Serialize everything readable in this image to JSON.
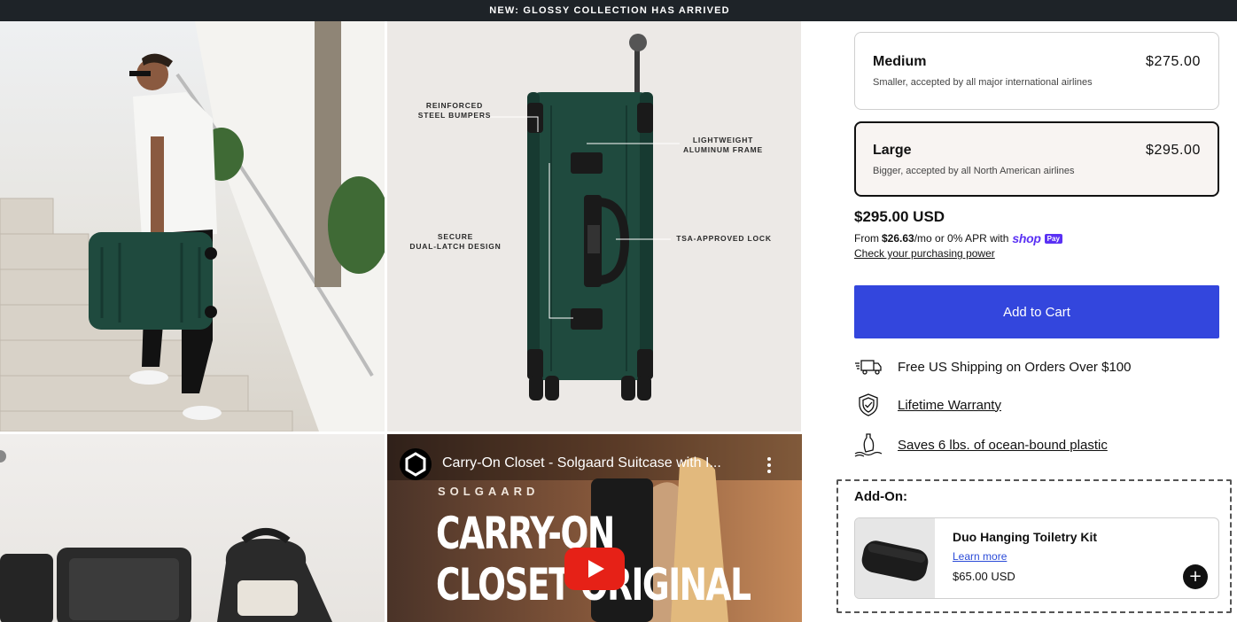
{
  "announcement": "NEW: GLOSSY COLLECTION HAS ARRIVED",
  "gallery": {
    "callouts": {
      "reinforced": "REINFORCED\nSTEEL BUMPERS",
      "lightweight": "LIGHTWEIGHT\nALUMINUM FRAME",
      "latch": "SECURE\nDUAL-LATCH DESIGN",
      "lock": "TSA-APPROVED LOCK"
    },
    "video": {
      "title": "Carry-On Closet - Solgaard Suitcase with I...",
      "brand": "SOLGAARD",
      "headline_line1": "CARRY-ON",
      "headline_line2": "CLOSET ORIGINAL"
    }
  },
  "sizes": [
    {
      "name": "Medium",
      "price": "$275.00",
      "description": "Smaller, accepted by all major international airlines",
      "selected": false
    },
    {
      "name": "Large",
      "price": "$295.00",
      "description": "Bigger, accepted by all North American airlines",
      "selected": true
    }
  ],
  "price": "$295.00 USD",
  "installments": {
    "prefix": "From",
    "amount": "$26.63",
    "suffix": "/mo or 0% APR with",
    "shop_logo": "shop",
    "shop_badge": "Pay"
  },
  "purchasing_power": "Check your purchasing power",
  "add_to_cart": "Add to Cart",
  "features": [
    {
      "icon": "truck-icon",
      "text": "Free US Shipping on Orders Over $100"
    },
    {
      "icon": "shield-check-icon",
      "text": "Lifetime Warranty"
    },
    {
      "icon": "bottle-icon",
      "text": "Saves 6 lbs. of ocean-bound plastic"
    }
  ],
  "addon": {
    "label": "Add-On:",
    "name": "Duo Hanging Toiletry Kit",
    "link": "Learn more",
    "price": "$65.00 USD",
    "plus": "+"
  },
  "colors": {
    "accent": "#3346dd",
    "topbar": "#1e2328",
    "shop_pay": "#5a31f4",
    "suitcase": "#1f4a3e",
    "youtube_red": "#e62117"
  }
}
